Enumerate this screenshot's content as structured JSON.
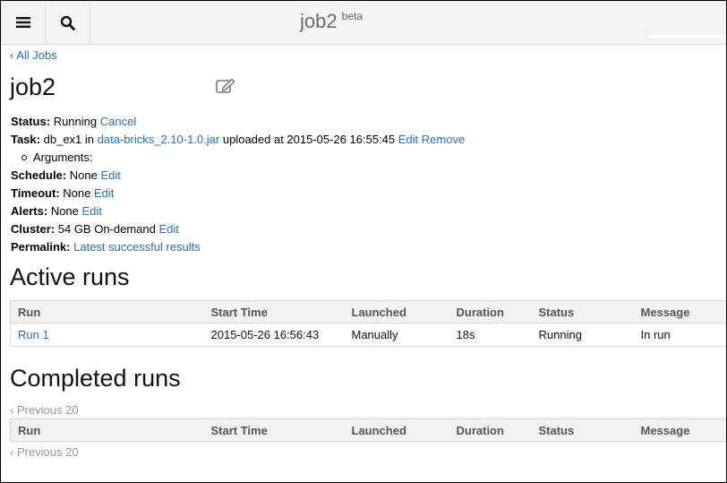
{
  "header": {
    "title": "job2",
    "badge": "beta",
    "menu_icon": "hamburger-menu-icon",
    "search_icon": "search-icon"
  },
  "nav": {
    "back_link": "‹ All Jobs"
  },
  "job": {
    "name": "job2",
    "status": {
      "label": "Status:",
      "value": "Running",
      "action": "Cancel"
    },
    "task": {
      "label": "Task:",
      "main_class": "db_ex1",
      "in_text": "in",
      "jar_link": "data-bricks_2.10-1.0.jar",
      "uploaded_text": "uploaded at 2015-05-26 16:55:45",
      "edit": "Edit",
      "remove": "Remove"
    },
    "arguments": {
      "label": "Arguments:"
    },
    "schedule": {
      "label": "Schedule:",
      "value": "None",
      "action": "Edit"
    },
    "timeout": {
      "label": "Timeout:",
      "value": "None",
      "action": "Edit"
    },
    "alerts": {
      "label": "Alerts:",
      "value": "None",
      "action": "Edit"
    },
    "cluster": {
      "label": "Cluster:",
      "value": "54 GB On-demand",
      "action": "Edit"
    },
    "permalink": {
      "label": "Permalink:",
      "link": "Latest successful results"
    }
  },
  "active_runs": {
    "heading": "Active runs",
    "columns": [
      "Run",
      "Start Time",
      "Launched",
      "Duration",
      "Status",
      "Message"
    ],
    "rows": [
      {
        "run": "Run 1",
        "start_time": "2015-05-26 16:56:43",
        "launched": "Manually",
        "duration": "18s",
        "status": "Running",
        "message": "In run"
      }
    ]
  },
  "completed_runs": {
    "heading": "Completed runs",
    "pager_top": "‹ Previous 20",
    "pager_bottom": "‹ Previous 20",
    "columns": [
      "Run",
      "Start Time",
      "Launched",
      "Duration",
      "Status",
      "Message"
    ]
  }
}
